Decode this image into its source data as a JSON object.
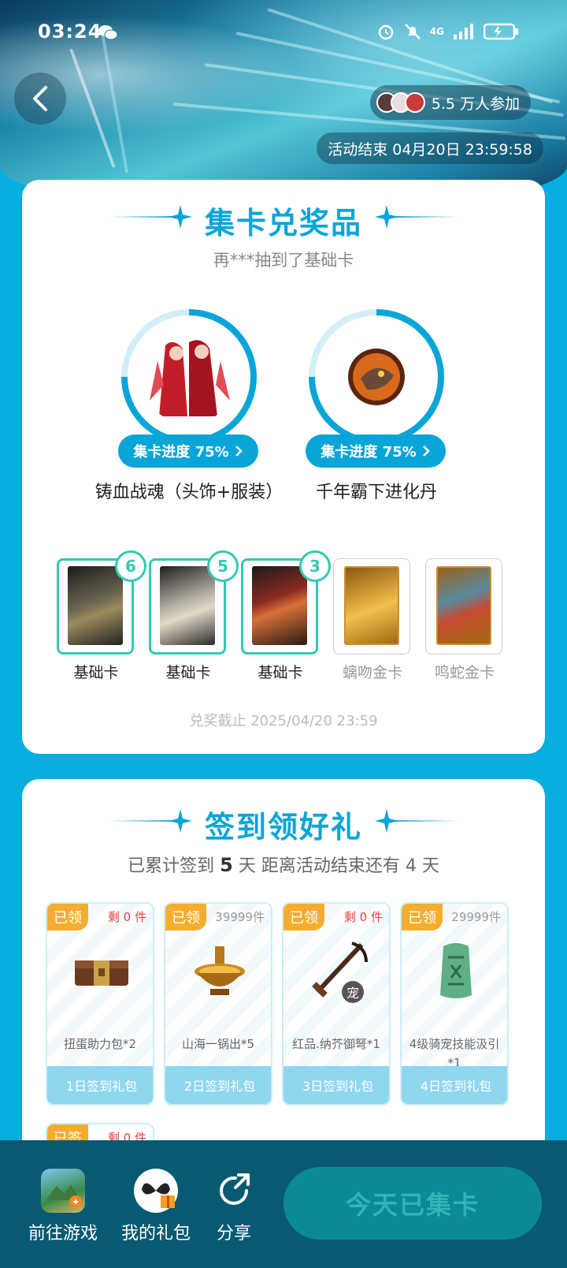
{
  "status_bar": {
    "time": "03:24",
    "network": "4G"
  },
  "header": {
    "participants": "5.5 万人参加",
    "end_time": "活动结束 04月20日 23:59:58"
  },
  "collect_section": {
    "title": "集卡兑奖品",
    "subtitle": "再***抽到了基础卡",
    "prizes": [
      {
        "name": "铸血战魂（头饰+服装）",
        "progress_label": "集卡进度 75%",
        "progress": 0.75
      },
      {
        "name": "千年霸下进化丹",
        "progress_label": "集卡进度 75%",
        "progress": 0.75
      }
    ],
    "cards": [
      {
        "label": "基础卡",
        "count": "6",
        "owned": true
      },
      {
        "label": "基础卡",
        "count": "5",
        "owned": true
      },
      {
        "label": "基础卡",
        "count": "3",
        "owned": true
      },
      {
        "label": "螭吻金卡",
        "count": "",
        "owned": false
      },
      {
        "label": "鸣蛇金卡",
        "count": "",
        "owned": false
      }
    ],
    "deadline": "兑奖截止 2025/04/20 23:59"
  },
  "signin_section": {
    "title": "签到领好礼",
    "info_prefix": "已累计签到",
    "days_signed": "5",
    "info_mid": "天  距离活动结束还有 4 天",
    "gifts": [
      {
        "status": "已领",
        "stock": "剩 0 件",
        "stock_red": true,
        "name": "扭蛋助力包*2",
        "footer": "1日签到礼包"
      },
      {
        "status": "已领",
        "stock": "39999件",
        "stock_red": false,
        "name": "山海一锅出*5",
        "footer": "2日签到礼包"
      },
      {
        "status": "已领",
        "stock": "剩 0 件",
        "stock_red": true,
        "name": "红品.纳芥御弩*1",
        "footer": "3日签到礼包"
      },
      {
        "status": "已领",
        "stock": "29999件",
        "stock_red": false,
        "name": "4级骑宠技能汲引*1",
        "footer": "4日签到礼包"
      }
    ],
    "gift5": {
      "status": "已签",
      "stock": "剩 0 件"
    },
    "pet_badge": "宠"
  },
  "bottom_bar": {
    "go_game": "前往游戏",
    "my_gifts": "我的礼包",
    "share": "分享",
    "cta": "今天已集卡"
  },
  "colors": {
    "accent": "#0aa5d8",
    "teal": "#35c9b1",
    "orange": "#f6ad2f",
    "bottom_bg": "#075a72"
  }
}
